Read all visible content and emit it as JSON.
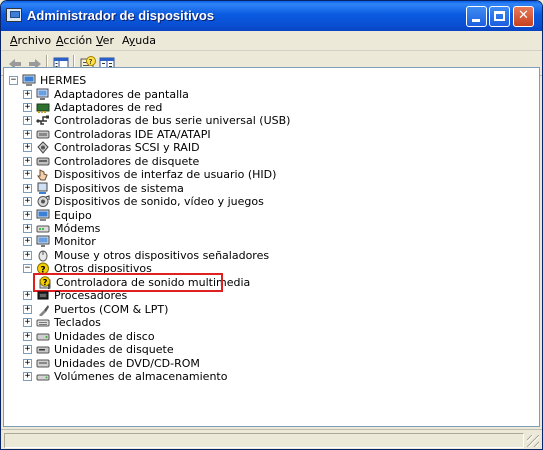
{
  "window": {
    "title": "Administrador de dispositivos"
  },
  "title_buttons": {
    "minimize_glyph": "_",
    "maximize_glyph": "□",
    "close_glyph": "✕"
  },
  "menu": {
    "items": [
      {
        "label": "Archivo",
        "underline_index": 0
      },
      {
        "label": "Acción",
        "underline_index": 0
      },
      {
        "label": "Ver",
        "underline_index": 0
      },
      {
        "label": "Ayuda",
        "underline_index": 1
      }
    ]
  },
  "toolbar": {
    "buttons": [
      {
        "name": "back-icon"
      },
      {
        "name": "forward-icon"
      },
      {
        "name": "show-hide-console-tree-icon"
      },
      {
        "name": "properties-help-icon"
      },
      {
        "name": "properties-icon"
      }
    ]
  },
  "tree": {
    "root": {
      "label": "HERMES",
      "expander": "−",
      "icon": "computer-icon"
    },
    "items": [
      {
        "label": "Adaptadores de pantalla",
        "expander": "+",
        "icon": "display-adapter-icon"
      },
      {
        "label": "Adaptadores de red",
        "expander": "+",
        "icon": "network-adapter-icon"
      },
      {
        "label": "Controladoras de bus serie universal (USB)",
        "expander": "+",
        "icon": "usb-icon"
      },
      {
        "label": "Controladoras IDE ATA/ATAPI",
        "expander": "+",
        "icon": "ide-controller-icon"
      },
      {
        "label": "Controladoras SCSI y RAID",
        "expander": "+",
        "icon": "scsi-raid-icon"
      },
      {
        "label": "Controladores de disquete",
        "expander": "+",
        "icon": "floppy-controller-icon"
      },
      {
        "label": "Dispositivos de interfaz de usuario (HID)",
        "expander": "+",
        "icon": "hid-icon"
      },
      {
        "label": "Dispositivos de sistema",
        "expander": "+",
        "icon": "system-device-icon"
      },
      {
        "label": "Dispositivos de sonido, vídeo y juegos",
        "expander": "+",
        "icon": "sound-video-icon"
      },
      {
        "label": "Equipo",
        "expander": "+",
        "icon": "computer-icon"
      },
      {
        "label": "Módems",
        "expander": "+",
        "icon": "modem-icon"
      },
      {
        "label": "Monitor",
        "expander": "+",
        "icon": "monitor-icon"
      },
      {
        "label": "Mouse y otros dispositivos señaladores",
        "expander": "+",
        "icon": "mouse-icon"
      },
      {
        "label": "Otros dispositivos",
        "expander": "−",
        "icon": "unknown-device-icon"
      },
      {
        "label": "Controladora de sonido multimedia",
        "expander": "",
        "icon": "warning-device-icon",
        "child": true,
        "highlighted": true
      },
      {
        "label": "Procesadores",
        "expander": "+",
        "icon": "processor-icon"
      },
      {
        "label": "Puertos (COM & LPT)",
        "expander": "+",
        "icon": "port-icon"
      },
      {
        "label": "Teclados",
        "expander": "+",
        "icon": "keyboard-icon"
      },
      {
        "label": "Unidades de disco",
        "expander": "+",
        "icon": "disk-drive-icon"
      },
      {
        "label": "Unidades de disquete",
        "expander": "+",
        "icon": "floppy-drive-icon"
      },
      {
        "label": "Unidades de DVD/CD-ROM",
        "expander": "+",
        "icon": "cdrom-icon"
      },
      {
        "label": "Volúmenes de almacenamiento",
        "expander": "+",
        "icon": "storage-volume-icon"
      }
    ]
  },
  "colors": {
    "title_bar": "#0a5ae0",
    "highlight_border": "#e02020",
    "warning_yellow": "#f5d000"
  }
}
